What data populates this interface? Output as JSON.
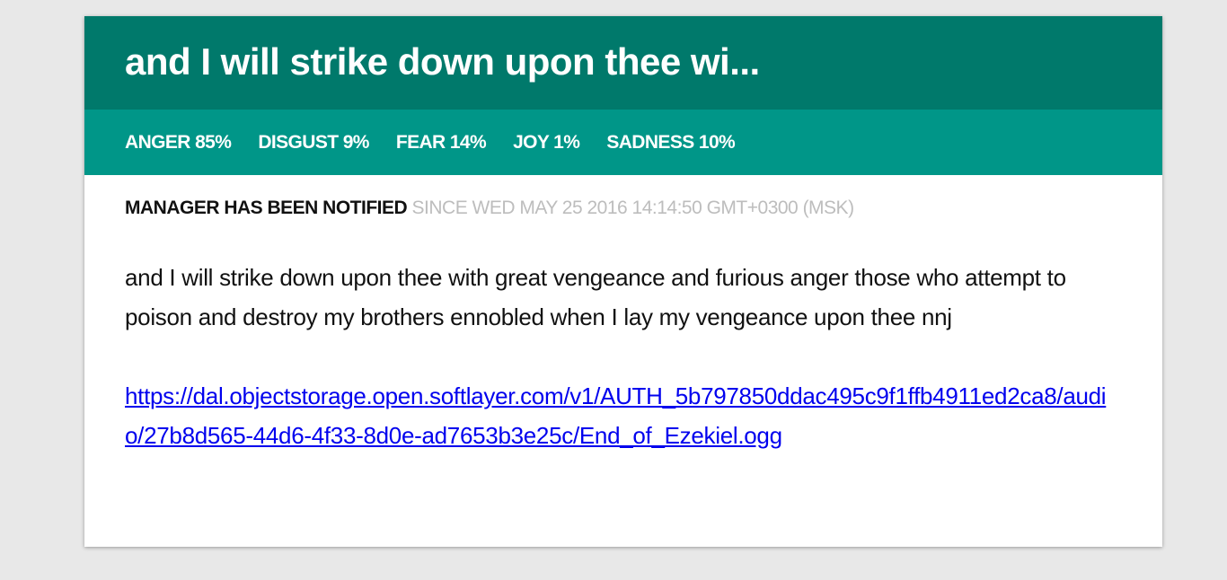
{
  "card": {
    "title": "and I will strike down upon thee wi...",
    "emotions": [
      {
        "name": "ANGER",
        "value": "85%",
        "label": "ANGER 85%"
      },
      {
        "name": "DISGUST",
        "value": "9%",
        "label": "DISGUST 9%"
      },
      {
        "name": "FEAR",
        "value": "14%",
        "label": "FEAR 14%"
      },
      {
        "name": "JOY",
        "value": "1%",
        "label": "JOY 1%"
      },
      {
        "name": "SADNESS",
        "value": "10%",
        "label": "SADNESS 10%"
      }
    ],
    "status": {
      "label": "Manager has been notified",
      "since": "since Wed May 25 2016 14:14:50 GMT+0300 (MSK)"
    },
    "message": "and I will strike down upon thee with great vengeance and furious anger those who attempt to poison and destroy my brothers  ennobled  when I lay my vengeance upon thee nnj",
    "audio_link": "https://dal.objectstorage.open.softlayer.com/v1/AUTH_5b797850ddac495c9f1ffb4911ed2ca8/audio/27b8d565-44d6-4f33-8d0e-ad7653b3e25c/End_of_Ezekiel.ogg"
  },
  "colors": {
    "header_bg": "#00796b",
    "emotion_bar_bg": "#009688",
    "page_bg": "#e8e8e8",
    "link": "#0000ee",
    "since_text": "#bdbdbd"
  }
}
